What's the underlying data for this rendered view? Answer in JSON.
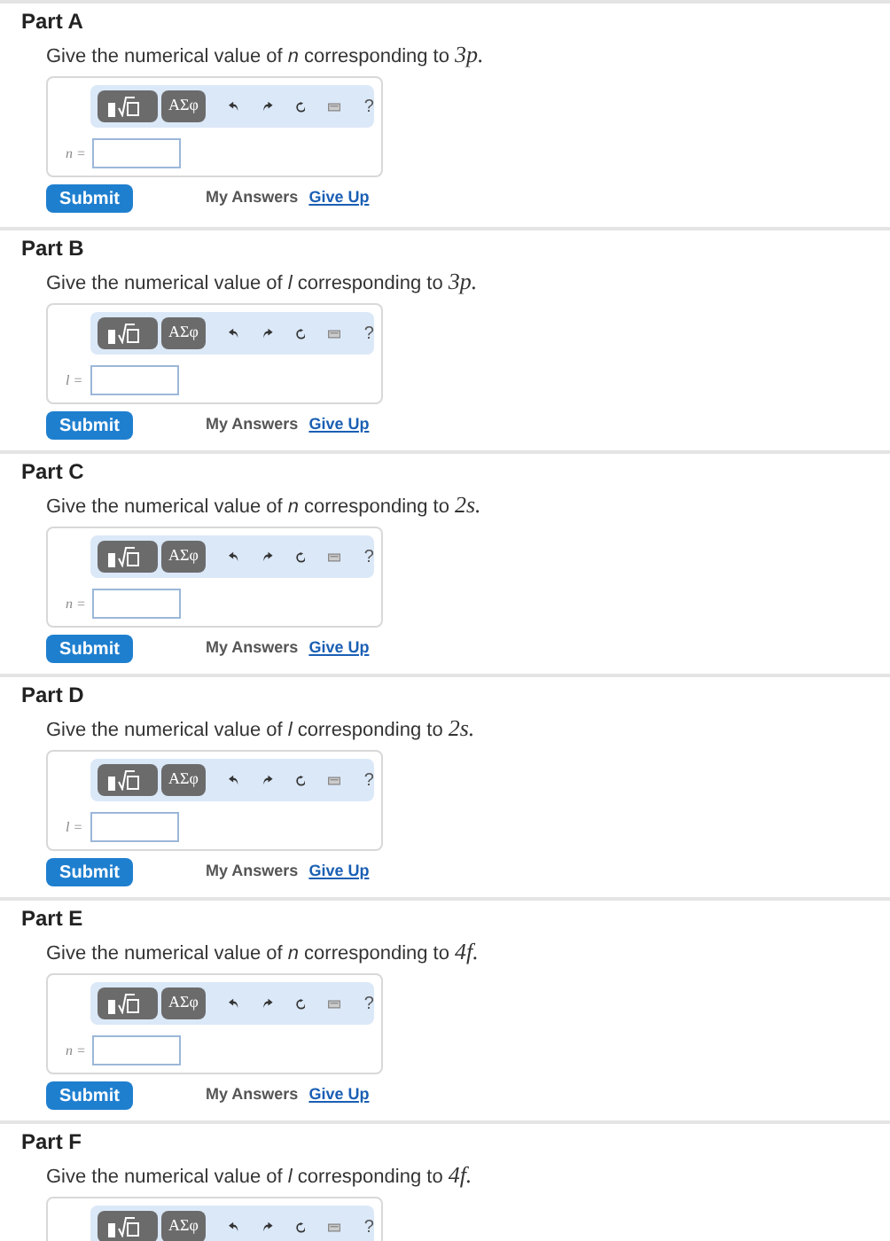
{
  "parts": [
    {
      "title": "Part A",
      "question": "Give the numerical value of *n* corresponding to",
      "orbital": "3p.",
      "toolbar": {
        "symbols": "ΑΣφ",
        "help": "?"
      },
      "input_label": "n =",
      "buttons": {
        "submit": "Submit",
        "my_answers": "My Answers",
        "give_up": "Give Up"
      }
    },
    {
      "title": "Part B",
      "question": "Give the numerical value of *l* corresponding to",
      "orbital": "3p.",
      "toolbar": {
        "symbols": "ΑΣφ",
        "help": "?"
      },
      "input_label": "l =",
      "buttons": {
        "submit": "Submit",
        "my_answers": "My Answers",
        "give_up": "Give Up"
      }
    },
    {
      "title": "Part C",
      "question": "Give the numerical value of *n* corresponding to",
      "orbital": "2s.",
      "toolbar": {
        "symbols": "ΑΣφ",
        "help": "?"
      },
      "input_label": "n =",
      "buttons": {
        "submit": "Submit",
        "my_answers": "My Answers",
        "give_up": "Give Up"
      }
    },
    {
      "title": "Part D",
      "question": "Give the numerical value of *l* corresponding to",
      "orbital": "2s.",
      "toolbar": {
        "symbols": "ΑΣφ",
        "help": "?"
      },
      "input_label": "l =",
      "buttons": {
        "submit": "Submit",
        "my_answers": "My Answers",
        "give_up": "Give Up"
      }
    },
    {
      "title": "Part E",
      "question": "Give the numerical value of *n* corresponding to",
      "orbital": "4f.",
      "toolbar": {
        "symbols": "ΑΣφ",
        "help": "?"
      },
      "input_label": "n =",
      "buttons": {
        "submit": "Submit",
        "my_answers": "My Answers",
        "give_up": "Give Up"
      }
    },
    {
      "title": "Part F",
      "question": "Give the numerical value of *l* corresponding to",
      "orbital": "4f.",
      "toolbar": {
        "symbols": "ΑΣφ",
        "help": "?"
      }
    }
  ]
}
